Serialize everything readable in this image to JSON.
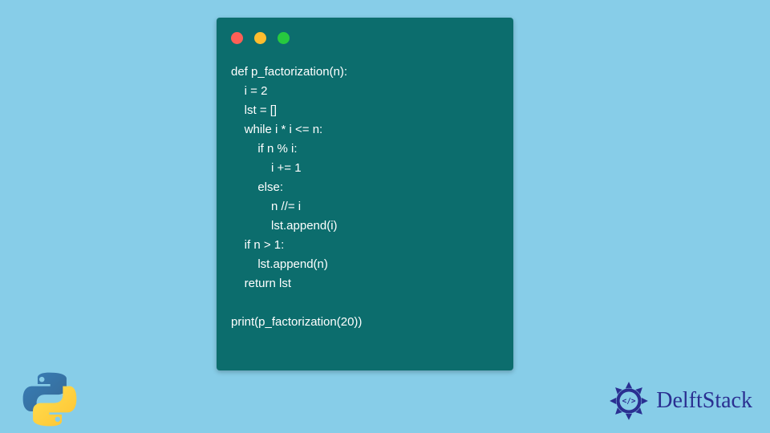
{
  "code": {
    "lines": [
      "def p_factorization(n):",
      "    i = 2",
      "    lst = []",
      "    while i * i <= n:",
      "        if n % i:",
      "            i += 1",
      "        else:",
      "            n //= i",
      "            lst.append(i)",
      "    if n > 1:",
      "        lst.append(n)",
      "    return lst",
      "",
      "print(p_factorization(20))"
    ]
  },
  "brand": {
    "name": "DelftStack"
  },
  "icons": {
    "python": "python-logo",
    "delft": "delftstack-badge"
  }
}
